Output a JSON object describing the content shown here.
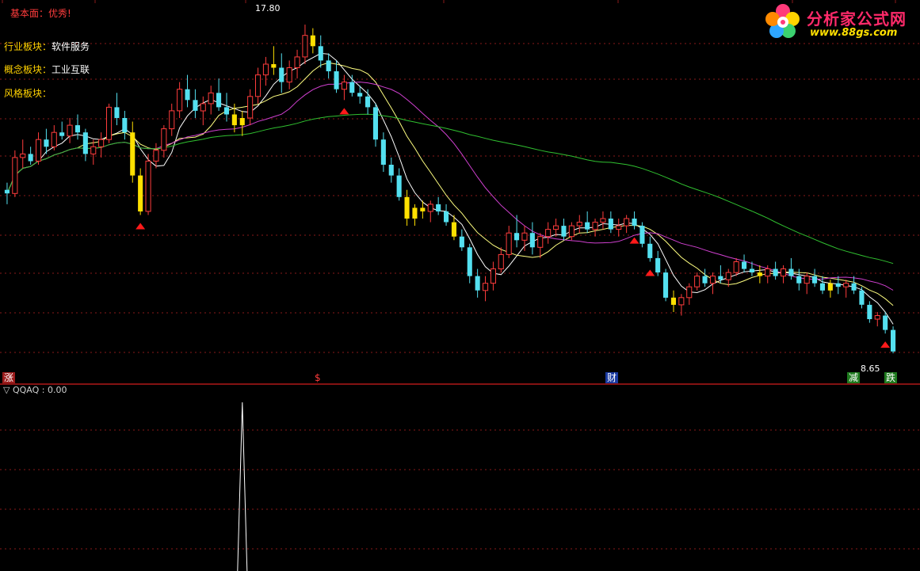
{
  "header": {
    "fundamental_label": "基本面：",
    "fundamental_value": "优秀!",
    "industry_label": "行业板块：",
    "industry_value": "软件服务",
    "concept_label": "概念板块：",
    "concept_value": "工业互联",
    "style_label": "风格板块："
  },
  "logo": {
    "name": "分析家公式网",
    "url": "www.88gs.com",
    "icon": "flower-icon"
  },
  "markers": {
    "high_label": "17.80",
    "low_label": "8.65",
    "bottom_signals": [
      {
        "text": "涨",
        "style": "red"
      },
      {
        "text": "$",
        "style": "red"
      },
      {
        "text": "财",
        "style": "blue"
      },
      {
        "text": "减",
        "style": "green"
      },
      {
        "text": "跌",
        "style": "green"
      }
    ]
  },
  "indicator": {
    "label": "▽ QQAQ : 0.00"
  },
  "colors": {
    "up": "#ff3c3c",
    "down": "#54e0f0",
    "signal": "#ffe000",
    "ma5": "#ffffff",
    "ma10": "#ffff80",
    "ma20": "#d040d0",
    "ma60": "#30c030",
    "grid": "#8a1a1a",
    "arrow": "#ff1a1a"
  },
  "chart_data": [
    {
      "type": "candlestick",
      "title": "",
      "ylim": [
        8.3,
        18.0
      ],
      "high": 17.8,
      "low": 8.65,
      "candles": [
        [
          13.2,
          13.4,
          12.8,
          13.1
        ],
        [
          13.1,
          14.3,
          13.0,
          14.1
        ],
        [
          14.1,
          14.6,
          13.8,
          14.2
        ],
        [
          14.2,
          14.4,
          13.9,
          14.0
        ],
        [
          14.0,
          14.8,
          13.9,
          14.6
        ],
        [
          14.6,
          14.9,
          14.2,
          14.4
        ],
        [
          14.4,
          15.0,
          14.3,
          14.8
        ],
        [
          14.8,
          15.1,
          14.6,
          14.7
        ],
        [
          14.7,
          15.2,
          14.5,
          15.0
        ],
        [
          15.0,
          15.3,
          14.6,
          14.8
        ],
        [
          14.8,
          14.9,
          14.0,
          14.2
        ],
        [
          14.2,
          14.6,
          13.9,
          14.4
        ],
        [
          14.4,
          14.8,
          14.1,
          14.6
        ],
        [
          14.6,
          15.6,
          14.5,
          15.5
        ],
        [
          15.5,
          15.9,
          15.0,
          15.2
        ],
        [
          15.2,
          15.4,
          14.6,
          14.8
        ],
        [
          14.8,
          15.1,
          13.4,
          13.6
        ],
        [
          13.6,
          13.8,
          12.5,
          12.6
        ],
        [
          12.6,
          14.2,
          12.5,
          14.0
        ],
        [
          14.0,
          14.5,
          13.8,
          14.3
        ],
        [
          14.3,
          15.0,
          14.1,
          14.9
        ],
        [
          14.9,
          15.6,
          14.7,
          15.4
        ],
        [
          15.4,
          16.2,
          15.2,
          16.0
        ],
        [
          16.0,
          16.4,
          15.5,
          15.7
        ],
        [
          15.7,
          16.0,
          15.2,
          15.4
        ],
        [
          15.4,
          15.8,
          15.0,
          15.6
        ],
        [
          15.6,
          16.1,
          15.3,
          15.9
        ],
        [
          15.9,
          16.3,
          15.4,
          15.5
        ],
        [
          15.5,
          15.9,
          15.1,
          15.3
        ],
        [
          15.3,
          15.6,
          14.8,
          15.0
        ],
        [
          15.0,
          15.4,
          14.7,
          15.2
        ],
        [
          15.2,
          16.0,
          15.0,
          15.8
        ],
        [
          15.8,
          16.6,
          15.6,
          16.4
        ],
        [
          16.4,
          16.9,
          16.1,
          16.7
        ],
        [
          16.7,
          17.2,
          16.4,
          16.6
        ],
        [
          16.6,
          17.0,
          15.9,
          16.2
        ],
        [
          16.2,
          16.8,
          16.0,
          16.6
        ],
        [
          16.6,
          17.1,
          16.3,
          16.9
        ],
        [
          16.9,
          17.8,
          16.7,
          17.5
        ],
        [
          17.5,
          17.7,
          17.0,
          17.2
        ],
        [
          17.2,
          17.5,
          16.6,
          16.8
        ],
        [
          16.8,
          17.0,
          16.3,
          16.5
        ],
        [
          16.5,
          16.8,
          15.9,
          16.0
        ],
        [
          16.0,
          16.4,
          15.7,
          16.2
        ],
        [
          16.2,
          16.4,
          15.8,
          15.9
        ],
        [
          15.9,
          16.1,
          15.6,
          15.8
        ],
        [
          15.8,
          16.0,
          15.3,
          15.5
        ],
        [
          15.5,
          15.6,
          14.4,
          14.6
        ],
        [
          14.6,
          14.8,
          13.7,
          13.9
        ],
        [
          13.9,
          14.1,
          13.4,
          13.6
        ],
        [
          13.6,
          13.8,
          12.9,
          13.0
        ],
        [
          13.0,
          13.2,
          12.2,
          12.4
        ],
        [
          12.4,
          12.8,
          12.2,
          12.7
        ],
        [
          12.7,
          12.9,
          12.4,
          12.6
        ],
        [
          12.6,
          12.9,
          12.3,
          12.8
        ],
        [
          12.8,
          13.0,
          12.5,
          12.6
        ],
        [
          12.6,
          12.8,
          12.2,
          12.3
        ],
        [
          12.3,
          12.5,
          11.8,
          11.9
        ],
        [
          11.9,
          12.1,
          11.5,
          11.6
        ],
        [
          11.6,
          11.7,
          10.6,
          10.8
        ],
        [
          10.8,
          11.0,
          10.2,
          10.4
        ],
        [
          10.4,
          10.8,
          10.1,
          10.6
        ],
        [
          10.6,
          11.2,
          10.4,
          11.0
        ],
        [
          11.0,
          11.6,
          10.9,
          11.4
        ],
        [
          11.4,
          12.2,
          11.3,
          12.0
        ],
        [
          12.0,
          12.5,
          11.6,
          11.8
        ],
        [
          11.8,
          12.2,
          11.5,
          12.0
        ],
        [
          12.0,
          12.3,
          11.4,
          11.6
        ],
        [
          11.6,
          12.0,
          11.3,
          11.9
        ],
        [
          11.9,
          12.3,
          11.7,
          12.1
        ],
        [
          12.1,
          12.4,
          11.9,
          12.2
        ],
        [
          12.2,
          12.4,
          11.8,
          11.9
        ],
        [
          11.9,
          12.3,
          11.8,
          12.2
        ],
        [
          12.2,
          12.5,
          12.0,
          12.3
        ],
        [
          12.3,
          12.6,
          12.0,
          12.1
        ],
        [
          12.1,
          12.4,
          11.9,
          12.3
        ],
        [
          12.3,
          12.6,
          12.1,
          12.4
        ],
        [
          12.4,
          12.6,
          12.0,
          12.1
        ],
        [
          12.1,
          12.4,
          11.9,
          12.2
        ],
        [
          12.2,
          12.5,
          12.0,
          12.4
        ],
        [
          12.4,
          12.6,
          12.1,
          12.2
        ],
        [
          12.2,
          12.3,
          11.6,
          11.7
        ],
        [
          11.7,
          11.9,
          11.2,
          11.3
        ],
        [
          11.3,
          11.5,
          10.8,
          10.9
        ],
        [
          10.9,
          11.0,
          10.1,
          10.2
        ],
        [
          10.2,
          10.4,
          9.8,
          10.0
        ],
        [
          10.0,
          10.3,
          9.7,
          10.2
        ],
        [
          10.2,
          10.6,
          10.0,
          10.5
        ],
        [
          10.5,
          10.9,
          10.4,
          10.8
        ],
        [
          10.8,
          11.0,
          10.5,
          10.6
        ],
        [
          10.6,
          10.9,
          10.3,
          10.8
        ],
        [
          10.8,
          11.1,
          10.6,
          10.7
        ],
        [
          10.7,
          11.0,
          10.5,
          10.9
        ],
        [
          10.9,
          11.3,
          10.8,
          11.2
        ],
        [
          11.2,
          11.4,
          10.9,
          11.0
        ],
        [
          11.0,
          11.2,
          10.8,
          10.9
        ],
        [
          10.9,
          11.1,
          10.6,
          10.8
        ],
        [
          10.8,
          11.1,
          10.6,
          11.0
        ],
        [
          11.0,
          11.2,
          10.7,
          10.8
        ],
        [
          10.8,
          11.1,
          10.6,
          11.0
        ],
        [
          11.0,
          11.3,
          10.7,
          10.8
        ],
        [
          10.8,
          11.0,
          10.4,
          10.6
        ],
        [
          10.6,
          10.9,
          10.3,
          10.8
        ],
        [
          10.8,
          11.0,
          10.5,
          10.6
        ],
        [
          10.6,
          10.8,
          10.3,
          10.4
        ],
        [
          10.4,
          10.7,
          10.2,
          10.6
        ],
        [
          10.6,
          10.8,
          10.3,
          10.5
        ],
        [
          10.5,
          10.7,
          10.2,
          10.6
        ],
        [
          10.6,
          10.8,
          10.3,
          10.4
        ],
        [
          10.4,
          10.5,
          9.9,
          10.0
        ],
        [
          10.0,
          10.1,
          9.5,
          9.6
        ],
        [
          9.6,
          9.8,
          9.4,
          9.7
        ],
        [
          9.7,
          9.8,
          9.2,
          9.3
        ],
        [
          9.3,
          9.4,
          8.65,
          8.7
        ]
      ],
      "signal_candles": [
        16,
        17,
        29,
        30,
        34,
        39,
        51,
        52,
        53,
        57,
        85,
        96,
        105
      ],
      "up_arrows": [
        17,
        43,
        80,
        82,
        112,
        123
      ],
      "ma_windows": [
        5,
        10,
        20,
        60
      ],
      "grid": true
    },
    {
      "type": "line",
      "name": "QQAQ",
      "ylim": [
        0,
        1
      ],
      "x_points": 123,
      "spike_index": 30,
      "spike_value": 1,
      "values_default": 0
    }
  ]
}
